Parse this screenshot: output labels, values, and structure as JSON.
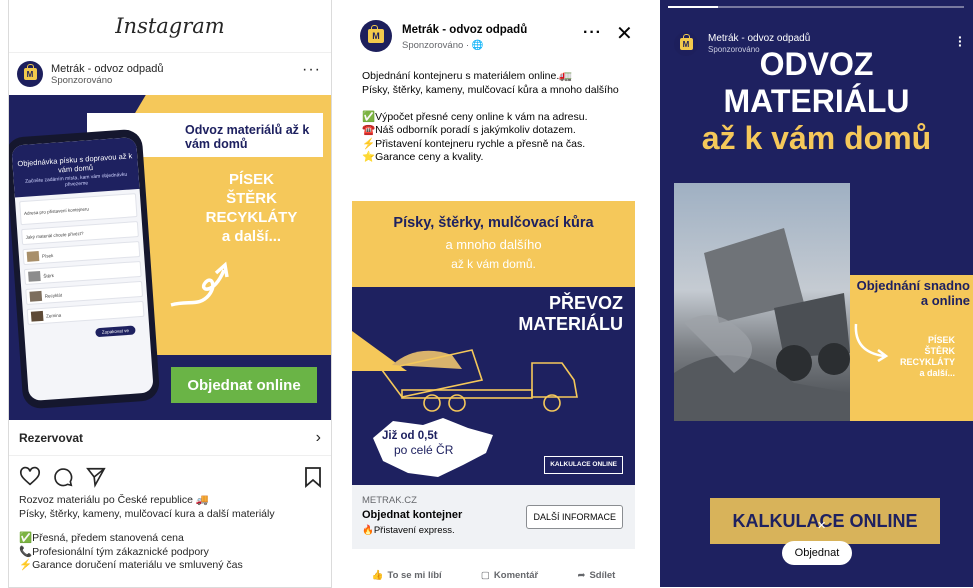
{
  "instagram": {
    "logo": "Instagram",
    "account_name": "Metrák - odvoz odpadů",
    "sponsored": "Sponzorováno",
    "creative": {
      "banner_title": "Odvoz materiálů až k vám domů",
      "materials": [
        "PÍSEK",
        "ŠTĚRK",
        "RECYKLÁTY",
        "a další..."
      ],
      "cta": "Objednat online",
      "phone_header": "Objednávka písku s dopravou až k vám domů",
      "phone_sub": "Začněte zadáním místa, kam vám objednávku přivezeme",
      "phone_rows": [
        "Adresa pro přistavení kontejneru",
        "Jaký materiál chcete přivézt?",
        "Písek",
        "Štěrk",
        "Recyklát",
        "Zemina"
      ],
      "phone_cta": "Zopakovat ve"
    },
    "link_label": "Rezervovat",
    "caption_lines": [
      "Rozvoz materiálu po České republice 🚚",
      "Písky, štěrky, kameny, mulčovací kura a další materiály"
    ],
    "bullets": [
      "✅Přesná, předem stanovená cena",
      "📞Profesionální tým zákaznické podpory",
      "⚡Garance doručení materiálu ve smluvený čas"
    ]
  },
  "facebook": {
    "account_name": "Metrák - odvoz odpadů",
    "sponsored": "Sponzorováno · 🌐",
    "more": "···",
    "close": "✕",
    "text_lines": [
      "Objednání kontejneru s materiálem online.🚛",
      "Písky, štěrky, kameny, mulčovací kůra a mnoho dalšího"
    ],
    "bullets": [
      "✅Výpočet přesné ceny online k vám na adresu.",
      "☎️Náš odborník poradí s jakýmkoliv dotazem.",
      "⚡Přistavení kontejneru rychle a přesně na čas.",
      "⭐Garance ceny a kvality."
    ],
    "creative": {
      "headline": "Písky, štěrky, mulčovací kůra",
      "line2": "a mnoho dalšího",
      "line3": "až k vám domů.",
      "big_line1": "PŘEVOZ",
      "big_line2": "MATERIÁLU",
      "from_line": "Již od 0,5t",
      "country_line": "po celé ČR",
      "calc": "KALKULACE ONLINE"
    },
    "footer": {
      "domain": "METRAK.CZ",
      "title": "Objednat kontejner",
      "subtitle": "🔥Přistavení express.",
      "button": "DALŠÍ INFORMACE"
    },
    "actions": {
      "like": "To se mi líbí",
      "comment": "Komentář",
      "share": "Sdílet"
    }
  },
  "story": {
    "account_name": "Metrák - odvoz odpadů",
    "sponsored": "Sponzorováno",
    "headline_1": "ODVOZ",
    "headline_2": "MATERIÁLU",
    "headline_3": "až k vám domů",
    "order_text": "Objednání snadno a online",
    "materials": [
      "PÍSEK",
      "ŠTĚRK",
      "RECYKLÁTY",
      "a další..."
    ],
    "cta": "KALKULACE ONLINE",
    "order_button": "Objednat"
  },
  "colors": {
    "navy": "#1e2160",
    "yellow": "#f5c85a",
    "green": "#6ab446"
  }
}
